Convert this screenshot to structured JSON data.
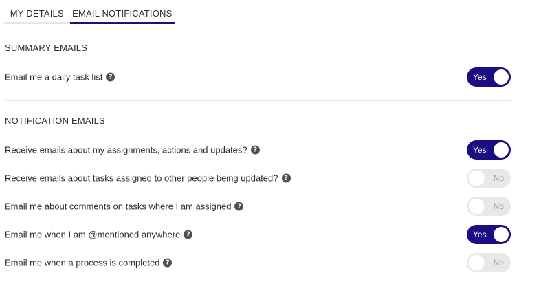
{
  "tabs": [
    {
      "label": "MY DETAILS",
      "active": false
    },
    {
      "label": "EMAIL NOTIFICATIONS",
      "active": true
    }
  ],
  "sections": {
    "summary": "SUMMARY EMAILS",
    "notification": "NOTIFICATION EMAILS"
  },
  "settings": [
    {
      "label": "Email me a daily task list",
      "state": "Yes",
      "on": true,
      "help_icon": "question-icon"
    },
    {
      "label": "Receive emails about my assignments, actions and updates?",
      "state": "Yes",
      "on": true,
      "help_icon": "question-icon"
    },
    {
      "label": "Receive emails about tasks assigned to other people being updated?",
      "state": "No",
      "on": false,
      "help_icon": "question-icon"
    },
    {
      "label": "Email me about comments on tasks where I am assigned",
      "state": "No",
      "on": false,
      "help_icon": "question-icon"
    },
    {
      "label": "Email me when I am @mentioned anywhere",
      "state": "Yes",
      "on": true,
      "help_icon": "question-icon"
    },
    {
      "label": "Email me when a process is completed",
      "state": "No",
      "on": false,
      "help_icon": "question-icon"
    }
  ],
  "help_glyph": "?",
  "colors": {
    "accent": "#1c0d82",
    "toggle_off": "#e8e8e8",
    "help_icon": "#4e4e58"
  }
}
